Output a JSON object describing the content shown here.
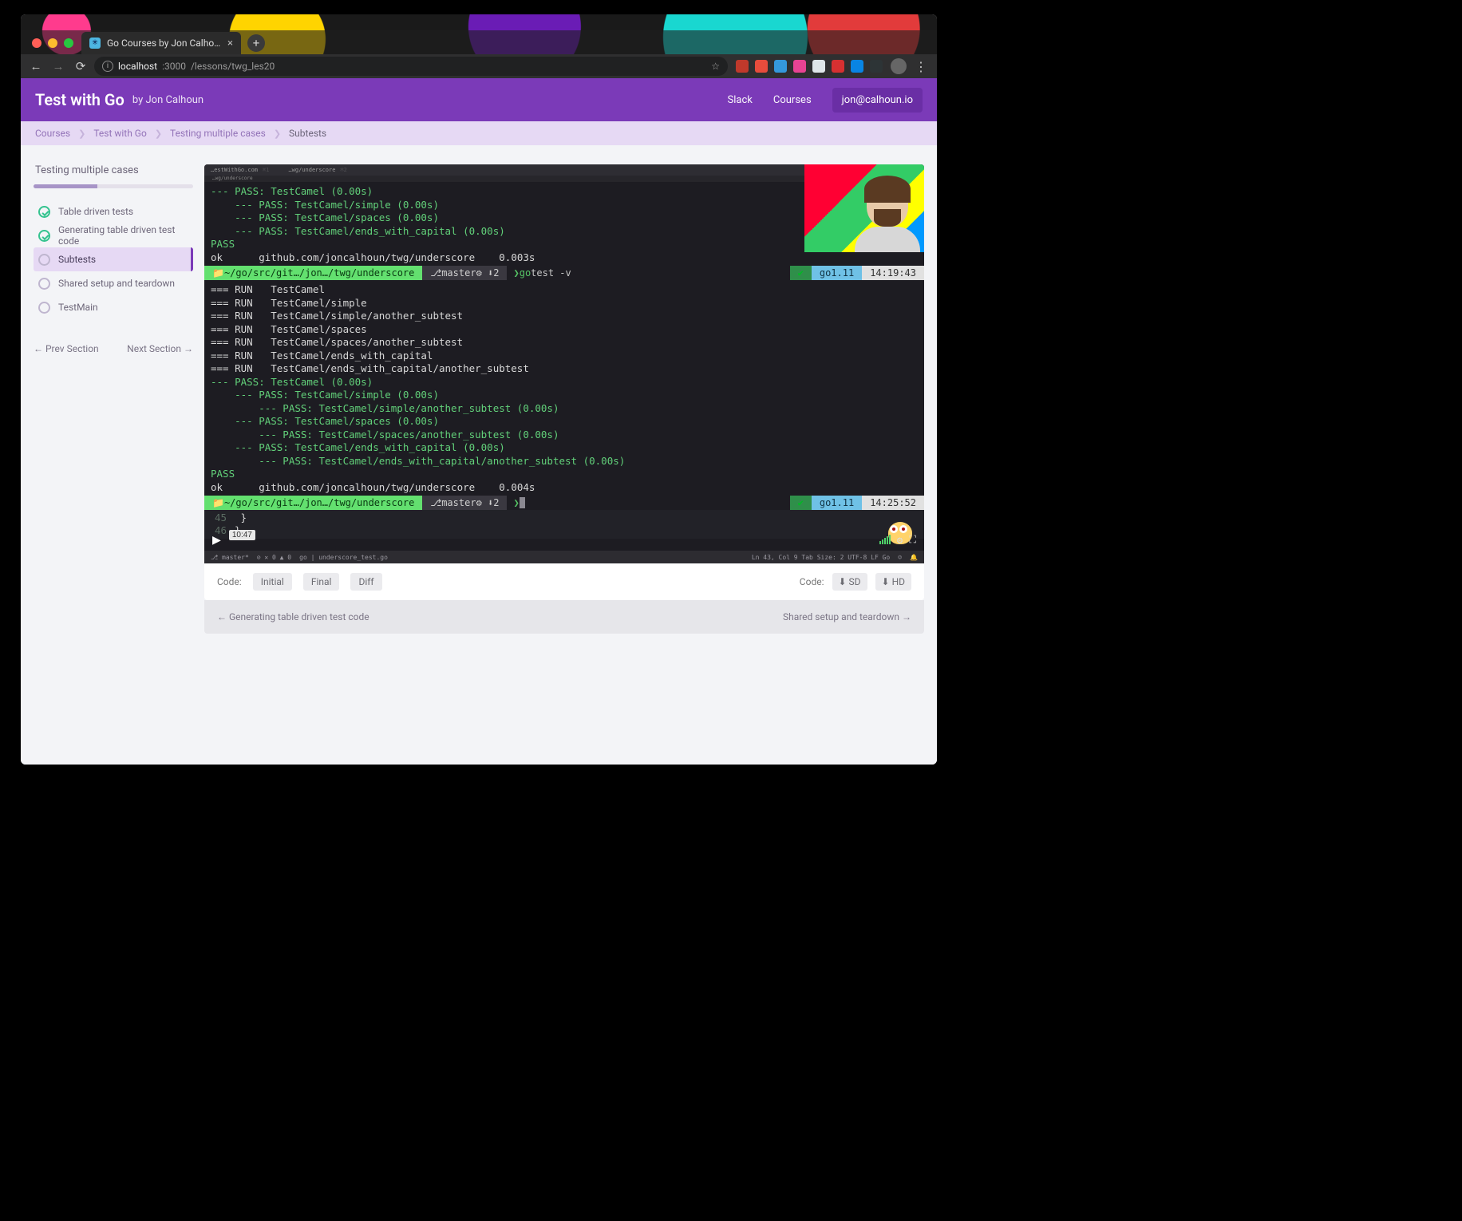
{
  "browser": {
    "tab_title": "Go Courses by Jon Calhoun",
    "url_host": "localhost",
    "url_port": ":3000",
    "url_path": "/lessons/twg_les20"
  },
  "header": {
    "brand": "Test with Go",
    "byline": "by Jon Calhoun",
    "links": {
      "slack": "Slack",
      "courses": "Courses"
    },
    "account": "jon@calhoun.io"
  },
  "crumbs": {
    "a": "Courses",
    "b": "Test with Go",
    "c": "Testing multiple cases",
    "d": "Subtests"
  },
  "sidebar": {
    "section_title": "Testing multiple cases",
    "progress_pct": 40,
    "lessons": [
      {
        "label": "Table driven tests",
        "done": true,
        "active": false
      },
      {
        "label": "Generating table driven test code",
        "done": true,
        "active": false
      },
      {
        "label": "Subtests",
        "done": false,
        "active": true
      },
      {
        "label": "Shared setup and teardown",
        "done": false,
        "active": false
      },
      {
        "label": "TestMain",
        "done": false,
        "active": false
      }
    ],
    "prev": "Prev Section",
    "next": "Next Section"
  },
  "terminal": {
    "tabs": {
      "a": "…estWithGo.com",
      "b": "…wg/underscore"
    },
    "block1": [
      "--- PASS: TestCamel (0.00s)",
      "    --- PASS: TestCamel/simple (0.00s)",
      "    --- PASS: TestCamel/spaces (0.00s)",
      "    --- PASS: TestCamel/ends_with_capital (0.00s)",
      "PASS"
    ],
    "ok1_repo": "github.com/joncalhoun/twg/underscore",
    "ok1_time": "0.003s",
    "prompt_path": "~/go/src/git…/jon…/twg/underscore",
    "prompt_branch": "master",
    "prompt_badge": "2",
    "cmd": "go test -v",
    "go_ver": "go1.11",
    "clock1": "14:19:43",
    "runs": [
      "=== RUN   TestCamel",
      "=== RUN   TestCamel/simple",
      "=== RUN   TestCamel/simple/another_subtest",
      "=== RUN   TestCamel/spaces",
      "=== RUN   TestCamel/spaces/another_subtest",
      "=== RUN   TestCamel/ends_with_capital",
      "=== RUN   TestCamel/ends_with_capital/another_subtest"
    ],
    "block2": [
      "--- PASS: TestCamel (0.00s)",
      "    --- PASS: TestCamel/simple (0.00s)",
      "        --- PASS: TestCamel/simple/another_subtest (0.00s)",
      "    --- PASS: TestCamel/spaces (0.00s)",
      "        --- PASS: TestCamel/spaces/another_subtest (0.00s)",
      "    --- PASS: TestCamel/ends_with_capital (0.00s)",
      "        --- PASS: TestCamel/ends_with_capital/another_subtest (0.00s)",
      "PASS"
    ],
    "ok2_repo": "github.com/joncalhoun/twg/underscore",
    "ok2_time": "0.004s",
    "clock2": "14:25:52",
    "editor_lines": [
      {
        "n": "45",
        "t": "    }"
      },
      {
        "n": "46",
        "t": "}"
      }
    ],
    "video_time": "10:47",
    "status_left_a": "master*",
    "status_left_b": "go | underscore_test.go",
    "status_right": "Ln 43, Col 9   Tab Size: 2   UTF-8   LF   Go"
  },
  "coderow": {
    "label_left": "Code:",
    "initial": "Initial",
    "final": "Final",
    "diff": "Diff",
    "label_right": "Code:",
    "sd": "SD",
    "hd": "HD"
  },
  "footer": {
    "prev": "Generating table driven test code",
    "next": "Shared setup and teardown"
  }
}
